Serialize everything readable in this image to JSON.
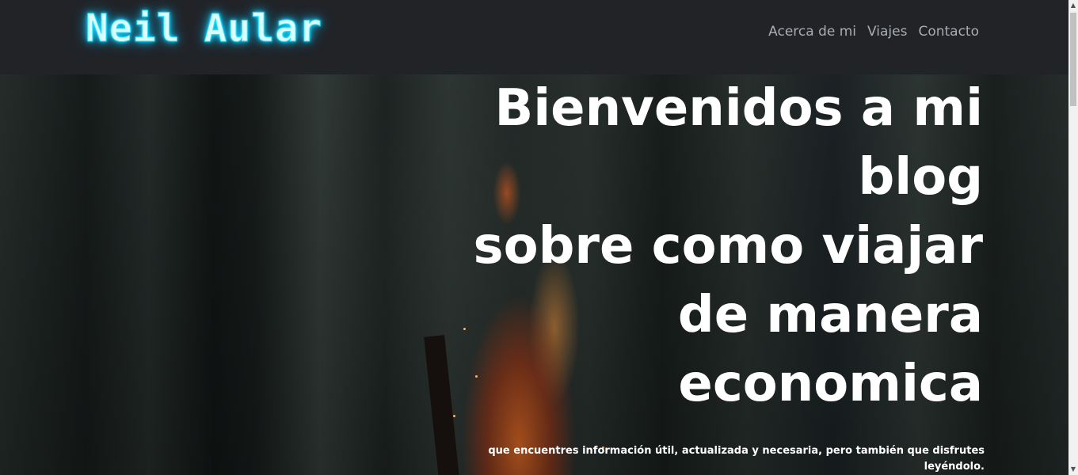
{
  "brand": {
    "logo_text": "Neil Aular",
    "logo_color": "#20dfff"
  },
  "nav": {
    "items": [
      {
        "label": "Acerca de mi"
      },
      {
        "label": "Viajes"
      },
      {
        "label": "Contacto"
      }
    ]
  },
  "hero": {
    "heading_lines": [
      "Bienvenidos a mi",
      "blog",
      "sobre como viajar",
      "de manera",
      "economica"
    ],
    "subtext": "que encuentres información útil, actualizada y necesaria, pero también que disfrutes leyéndolo."
  },
  "scrollbar": {
    "up_icon": "triangle-up-icon",
    "down_icon": "triangle-down-icon"
  }
}
